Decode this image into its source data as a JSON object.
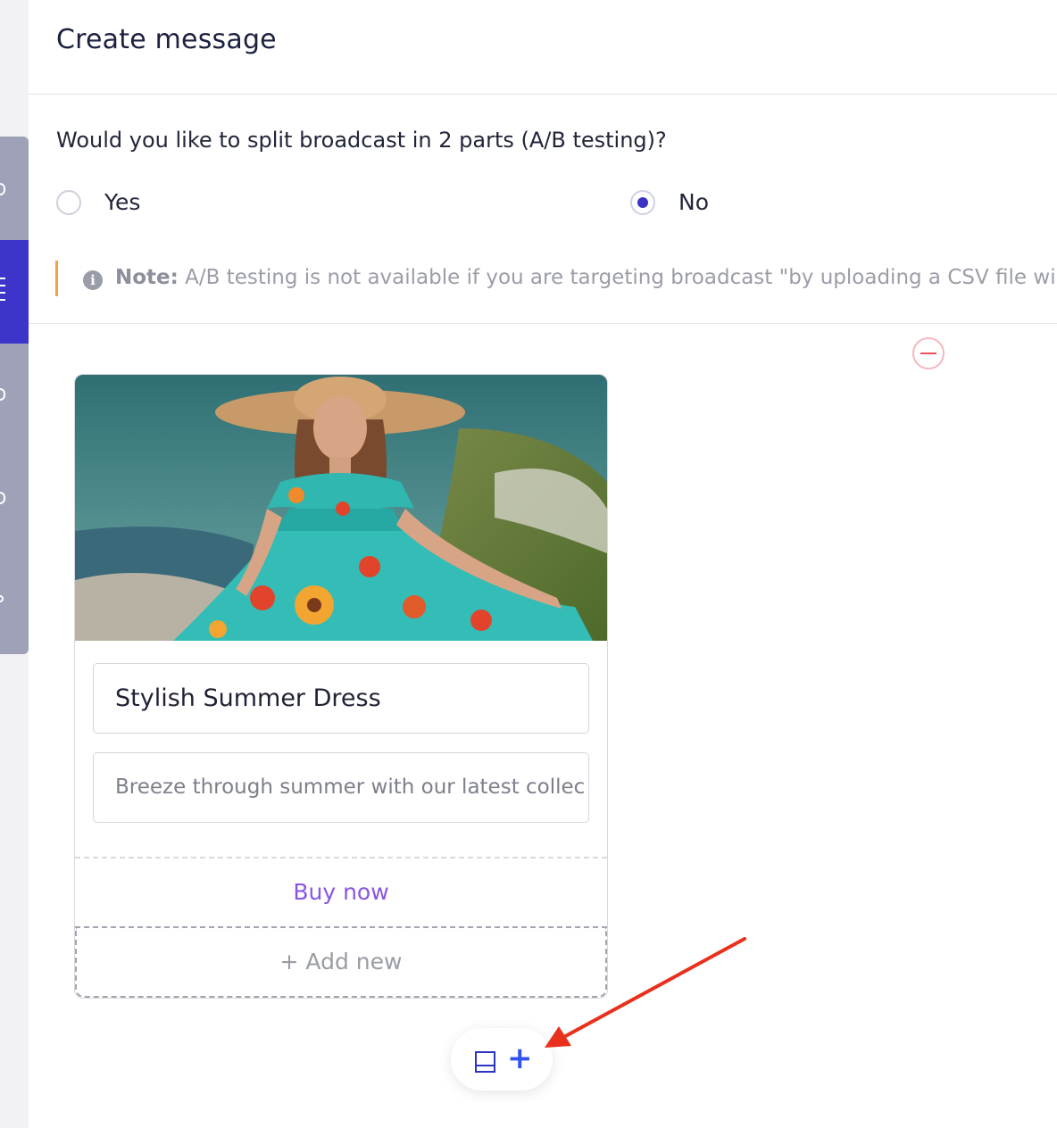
{
  "header": {
    "title": "Create message"
  },
  "ab_test": {
    "question": "Would you like to split broadcast in 2 parts (A/B testing)?",
    "options": [
      {
        "label": "Yes",
        "selected": false
      },
      {
        "label": "No",
        "selected": true
      }
    ],
    "note_label": "Note:",
    "note_text": "A/B testing is not available if you are targeting broadcast \"by uploading a CSV file wi"
  },
  "card": {
    "title_value": "Stylish Summer Dress",
    "description_value": "Breeze through summer with our latest collec",
    "button_label": "Buy now",
    "add_new_label": "+ Add new"
  },
  "colors": {
    "accent": "#3d35c9",
    "note_bar": "#f5a142",
    "button_text": "#8a55e0",
    "remove": "#ef4f5f",
    "annotation_arrow": "#e8301c"
  }
}
